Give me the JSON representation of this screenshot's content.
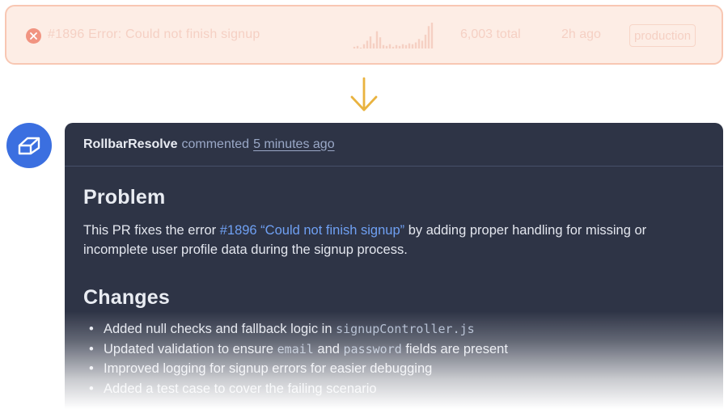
{
  "error_bar": {
    "title": "#1896 Error: Could not finish signup",
    "total": "6,003 total",
    "age": "2h ago",
    "environment": "production",
    "icon": "close-circle-icon",
    "accent_color": "#ea5b3e"
  },
  "comment": {
    "author": "RollbarResolve",
    "action": "commented",
    "time": "5 minutes ago",
    "avatar_icon": "rollbar-logo-icon",
    "problem_heading": "Problem",
    "problem_text_before": "This PR fixes the error ",
    "issue_link": "#1896 “Could not finish signup”",
    "problem_text_after": " by adding proper handling for missing or incomplete user profile data during the signup process.",
    "changes_heading": "Changes",
    "changes": [
      {
        "text": "Added null checks and fallback logic in ",
        "code": "signupController.js"
      },
      {
        "before": "Updated validation to ensure ",
        "code1": "email",
        "middle": " and ",
        "code2": "password",
        "after": " fields are present"
      },
      {
        "text": "Improved logging for signup errors for easier debugging"
      },
      {
        "text": "Added a test case to cover the failing scenario"
      }
    ]
  },
  "sparkline_values": [
    2,
    3,
    1,
    5,
    9,
    14,
    6,
    20,
    13,
    4,
    3,
    5,
    2,
    4,
    3,
    5,
    4,
    6,
    5,
    7,
    11,
    9,
    16,
    26,
    30
  ]
}
